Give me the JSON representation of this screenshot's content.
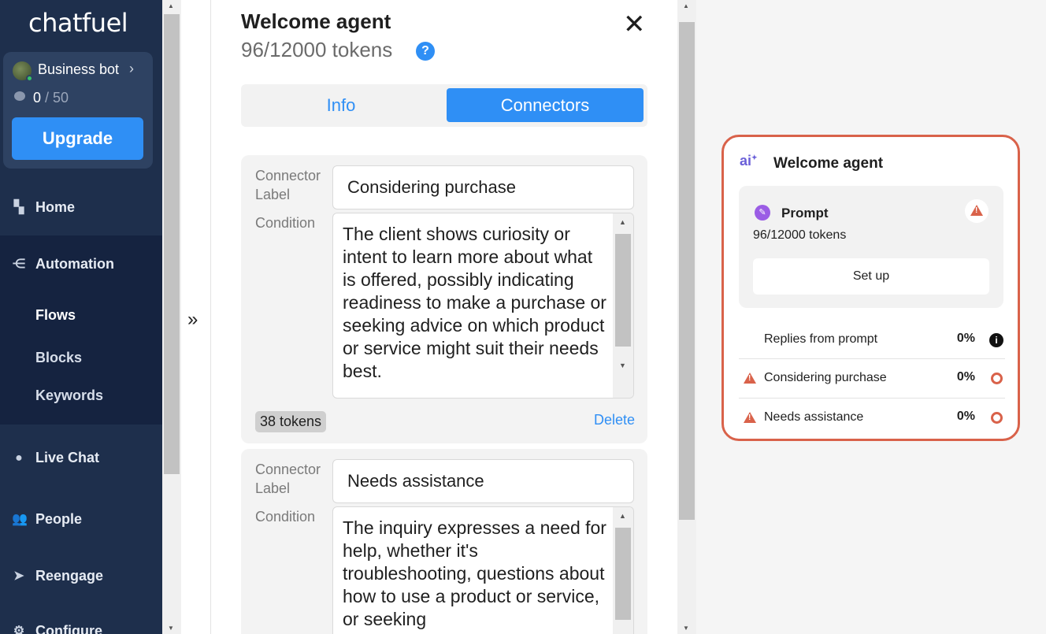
{
  "sidebar": {
    "logo": "chatfuel",
    "bot": {
      "name": "Business bot",
      "count_used": "0",
      "count_total": "/ 50"
    },
    "upgrade_label": "Upgrade",
    "nav": [
      {
        "label": "Home",
        "icon": "dashboard-icon"
      },
      {
        "label": "Automation",
        "icon": "flow-icon"
      },
      {
        "label": "Live Chat",
        "icon": "chat-bubble-icon"
      },
      {
        "label": "People",
        "icon": "people-icon"
      },
      {
        "label": "Reengage",
        "icon": "send-icon"
      },
      {
        "label": "Configure",
        "icon": "gear-icon"
      }
    ],
    "automation_sub": [
      "Flows",
      "Blocks",
      "Keywords"
    ]
  },
  "panel": {
    "title": "Welcome agent",
    "tokens": "96/12000 tokens",
    "help": "?",
    "tabs": {
      "info": "Info",
      "connectors": "Connectors"
    },
    "connectors": [
      {
        "label_caption": "Connector Label",
        "condition_caption": "Condition",
        "label": "Considering purchase",
        "condition": "The client shows curiosity or intent to learn more about what is offered, possibly indicating readiness to make a purchase or seeking advice on which product or service might suit their needs best.",
        "tokens": "38 tokens",
        "delete_label": "Delete"
      },
      {
        "label_caption": "Connector Label",
        "condition_caption": "Condition",
        "label": "Needs assistance",
        "condition": "The inquiry expresses a need for help, whether it's troubleshooting, questions about how to use a product or service, or seeking"
      }
    ]
  },
  "node": {
    "title": "Welcome agent",
    "prompt": {
      "title": "Prompt",
      "tokens": "96/12000 tokens",
      "setup_label": "Set up"
    },
    "rows": [
      {
        "label": "Replies from prompt",
        "pct": "0%",
        "warning": false
      },
      {
        "label": "Considering purchase",
        "pct": "0%",
        "warning": true
      },
      {
        "label": "Needs assistance",
        "pct": "0%",
        "warning": true
      }
    ],
    "accent_color": "#d9624a",
    "primary_color": "#2f8ff5"
  }
}
